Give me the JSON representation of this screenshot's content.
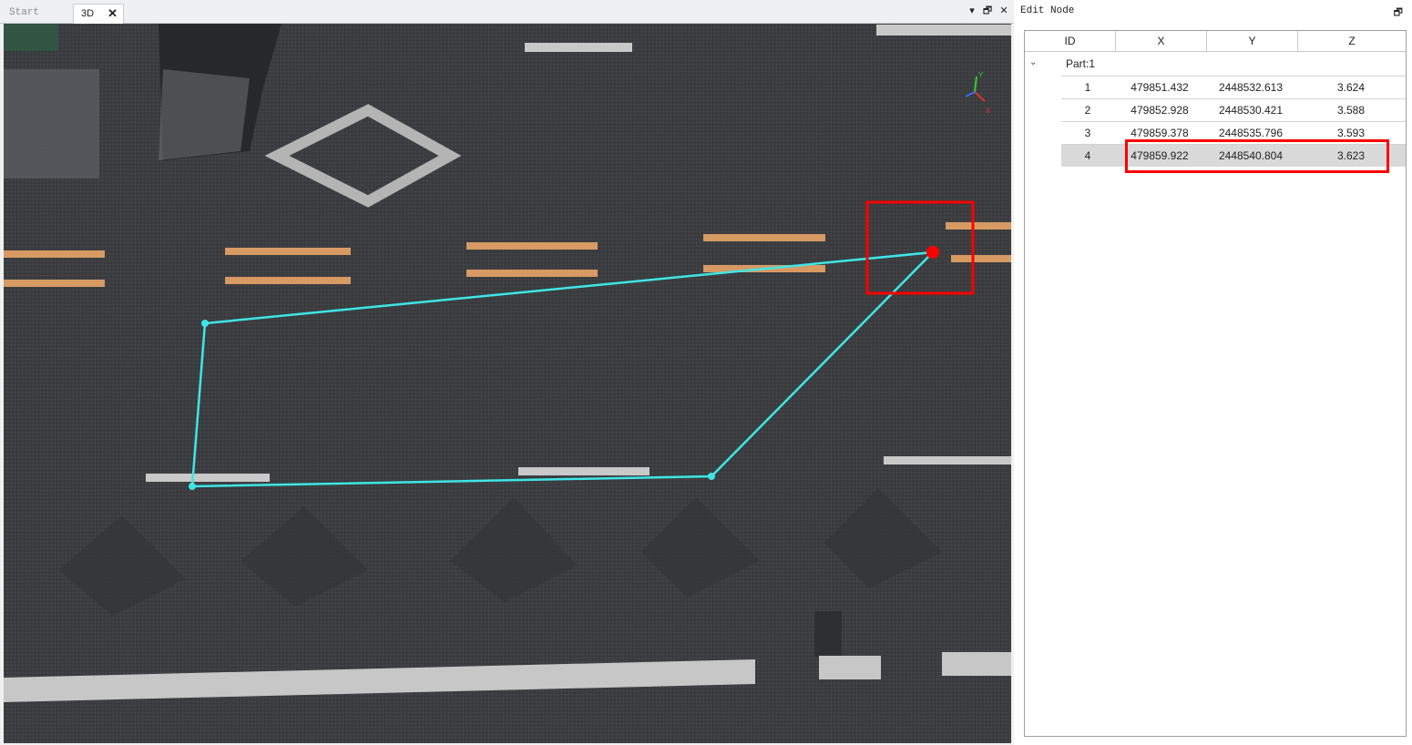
{
  "tabs": [
    {
      "label": "Start Page"
    },
    {
      "label": "3D",
      "close_icon": "close-icon",
      "close_glyph": "✕"
    }
  ],
  "window_controls": {
    "dropdown_glyph": "▾",
    "restore_glyph": "🗗",
    "close_glyph": "✕"
  },
  "panel": {
    "title": "Edit Node",
    "restore_glyph": "🗗",
    "columns": [
      "ID",
      "X",
      "Y",
      "Z"
    ],
    "group": {
      "label": "Part:1",
      "expander_glyph": "⌄",
      "expanded": true
    },
    "rows": [
      {
        "id": "1",
        "x": "479851.432",
        "y": "2448532.613",
        "z": "3.624"
      },
      {
        "id": "2",
        "x": "479852.928",
        "y": "2448530.421",
        "z": "3.588"
      },
      {
        "id": "3",
        "x": "479859.378",
        "y": "2448535.796",
        "z": "3.593"
      },
      {
        "id": "4",
        "x": "479859.922",
        "y": "2448540.804",
        "z": "3.623",
        "selected": true
      }
    ]
  },
  "colors": {
    "polygon": "#3ee6e6",
    "selected_node": "#ff0000",
    "highlight": "#ff0000",
    "road": "#3b3d40",
    "lane_yellow": "#e8a467",
    "lane_white": "#d8d8d8"
  },
  "viewport": {
    "axes_icon": "xyz-axes-icon",
    "axis_labels": [
      "Y",
      "X"
    ]
  }
}
